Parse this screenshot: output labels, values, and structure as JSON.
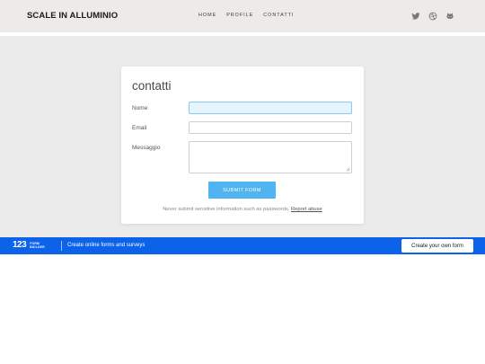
{
  "header": {
    "brand": "SCALE IN ALLUMINIO",
    "nav": [
      {
        "label": "HOME"
      },
      {
        "label": "PROFILE"
      },
      {
        "label": "CONTATTI"
      }
    ],
    "social_icons": [
      "twitter-icon",
      "dribbble-icon",
      "github-icon"
    ]
  },
  "form": {
    "title": "contatti",
    "fields": {
      "name": {
        "label": "Nome",
        "value": ""
      },
      "email": {
        "label": "Email",
        "value": ""
      },
      "message": {
        "label": "Messaggio",
        "value": ""
      }
    },
    "submit_label": "SUBMIT FORM",
    "note": "Never submit sensitive information such as passwords.",
    "report_link": "Report abuse"
  },
  "banner": {
    "logo_number": "123",
    "logo_line1": "FORM",
    "logo_line2": "BUILDER",
    "tagline": "Create online forms and surveys",
    "cta_label": "Create your own form"
  },
  "colors": {
    "banner_blue": "#0d62ea",
    "submit_blue": "#4fb4f0",
    "header_bg": "#ecebe8",
    "page_bg": "#ebebeb"
  }
}
